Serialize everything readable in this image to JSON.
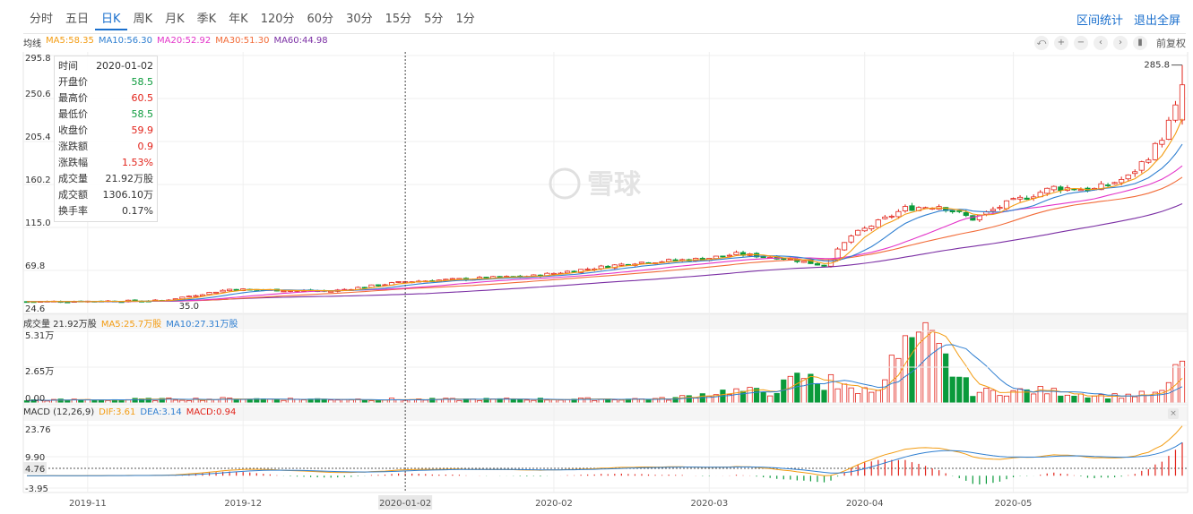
{
  "tabs": [
    {
      "label": "分时",
      "active": false
    },
    {
      "label": "五日",
      "active": false
    },
    {
      "label": "日K",
      "active": true
    },
    {
      "label": "周K",
      "active": false
    },
    {
      "label": "月K",
      "active": false
    },
    {
      "label": "季K",
      "active": false
    },
    {
      "label": "年K",
      "active": false
    },
    {
      "label": "120分",
      "active": false
    },
    {
      "label": "60分",
      "active": false
    },
    {
      "label": "30分",
      "active": false
    },
    {
      "label": "15分",
      "active": false
    },
    {
      "label": "5分",
      "active": false
    },
    {
      "label": "1分",
      "active": false
    }
  ],
  "links": {
    "range_stats": "区间统计",
    "exit_fullscreen": "退出全屏"
  },
  "ma_legend": {
    "title": "均线",
    "items": [
      {
        "text": "MA5:58.35",
        "color": "#f39c12"
      },
      {
        "text": "MA10:56.30",
        "color": "#2f7fd1"
      },
      {
        "text": "MA20:52.92",
        "color": "#e334c9"
      },
      {
        "text": "MA30:51.30",
        "color": "#f26b38"
      },
      {
        "text": "MA60:44.98",
        "color": "#7b2fa4"
      }
    ]
  },
  "toolbar": {
    "icons": [
      "undo-icon",
      "zoom-in-icon",
      "zoom-out-icon",
      "prev-icon",
      "next-icon",
      "candle-icon"
    ],
    "glyphs": [
      "⤺",
      "+",
      "−",
      "‹",
      "›",
      "▮"
    ],
    "adjust_label": "前复权"
  },
  "info_panel": {
    "rows": [
      {
        "k": "时间",
        "v": "2020-01-02",
        "cls": ""
      },
      {
        "k": "开盘价",
        "v": "58.5",
        "cls": "down"
      },
      {
        "k": "最高价",
        "v": "60.5",
        "cls": "up"
      },
      {
        "k": "最低价",
        "v": "58.5",
        "cls": "down"
      },
      {
        "k": "收盘价",
        "v": "59.9",
        "cls": "up"
      },
      {
        "k": "涨跌额",
        "v": "0.9",
        "cls": "up"
      },
      {
        "k": "涨跌幅",
        "v": "1.53%",
        "cls": "up"
      },
      {
        "k": "成交量",
        "v": "21.92万股",
        "cls": ""
      },
      {
        "k": "成交额",
        "v": "1306.10万",
        "cls": ""
      },
      {
        "k": "换手率",
        "v": "0.17%",
        "cls": ""
      }
    ]
  },
  "price_axis": [
    "295.8",
    "250.6",
    "205.4",
    "160.2",
    "115.0",
    "69.8",
    "24.6"
  ],
  "price_markers": {
    "high": "285.8",
    "low": "35.0"
  },
  "vol_legend": {
    "title": "成交量 21.92万股",
    "items": [
      {
        "text": "MA5:25.7万股",
        "color": "#f39c12"
      },
      {
        "text": "MA10:27.31万股",
        "color": "#2f7fd1"
      }
    ]
  },
  "vol_axis": [
    "5.31万",
    "2.65万",
    "0.00"
  ],
  "macd_legend": {
    "title": "MACD (12,26,9)",
    "items": [
      {
        "text": "DIF:3.61",
        "color": "#f39c12"
      },
      {
        "text": "DEA:3.14",
        "color": "#2f7fd1"
      },
      {
        "text": "MACD:0.94",
        "color": "#e2231a"
      }
    ]
  },
  "macd_axis": [
    "23.76",
    "9.90",
    "4.76",
    "-3.95"
  ],
  "x_axis": [
    "2019-11",
    "2019-12",
    "2020-01-02",
    "2020-02",
    "2020-03",
    "2020-04",
    "2020-05"
  ],
  "watermark": "雪球",
  "colors": {
    "up": "#e2231a",
    "down": "#0a9a3b",
    "accent": "#1a6fcd"
  },
  "chart_data": {
    "type": "candlestick",
    "title": "",
    "price_range": [
      24.6,
      295.8
    ],
    "volume_range": [
      0,
      53100
    ],
    "macd_range": [
      -3.95,
      23.76
    ],
    "month_index": [
      {
        "label": "2019-11",
        "i": 9
      },
      {
        "label": "2019-12",
        "i": 32
      },
      {
        "label": "2020-01-02",
        "i": 56
      },
      {
        "label": "2020-02",
        "i": 78
      },
      {
        "label": "2020-03",
        "i": 101
      },
      {
        "label": "2020-04",
        "i": 124
      },
      {
        "label": "2020-05",
        "i": 146
      }
    ],
    "crosshair_index": 56,
    "ma_colors": {
      "ma5": "#f39c12",
      "ma10": "#2f7fd1",
      "ma20": "#e334c9",
      "ma30": "#f26b38",
      "ma60": "#7b2fa4"
    },
    "keypoints": [
      [
        0,
        37
      ],
      [
        20,
        38
      ],
      [
        30,
        50
      ],
      [
        45,
        48
      ],
      [
        56,
        58
      ],
      [
        75,
        64
      ],
      [
        90,
        78
      ],
      [
        100,
        82
      ],
      [
        105,
        87
      ],
      [
        112,
        83
      ],
      [
        118,
        75
      ],
      [
        122,
        106
      ],
      [
        130,
        135
      ],
      [
        135,
        138
      ],
      [
        140,
        124
      ],
      [
        145,
        140
      ],
      [
        152,
        157
      ],
      [
        158,
        155
      ],
      [
        163,
        168
      ],
      [
        166,
        190
      ],
      [
        168,
        210
      ],
      [
        170,
        240
      ],
      [
        171,
        268
      ]
    ],
    "volume_keypoints": [
      [
        0,
        2000
      ],
      [
        30,
        3000
      ],
      [
        60,
        2500
      ],
      [
        95,
        3000
      ],
      [
        104,
        9000
      ],
      [
        110,
        8000
      ],
      [
        115,
        20000
      ],
      [
        118,
        12000
      ],
      [
        125,
        9000
      ],
      [
        132,
        52000
      ],
      [
        140,
        8000
      ],
      [
        150,
        9000
      ],
      [
        160,
        5000
      ],
      [
        168,
        7000
      ],
      [
        171,
        30000
      ]
    ]
  }
}
